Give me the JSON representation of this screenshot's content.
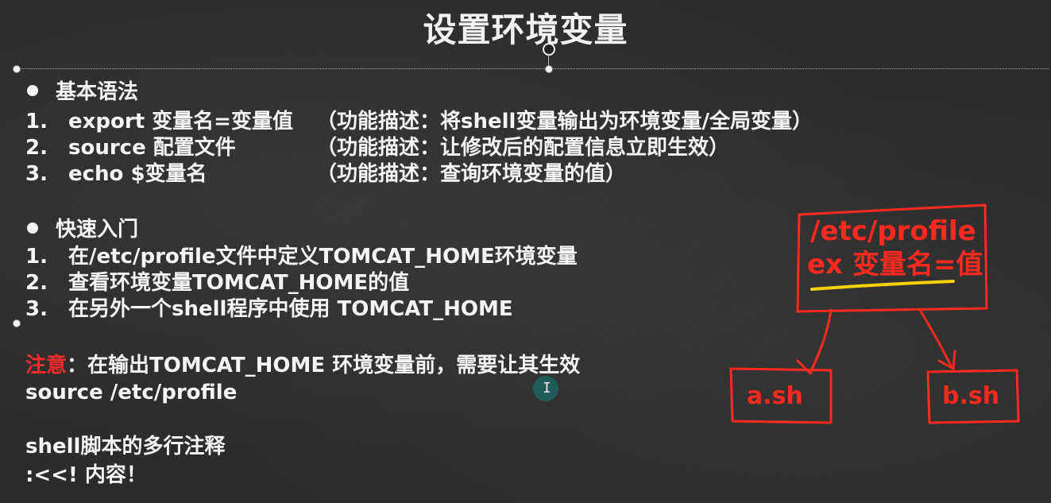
{
  "slide": {
    "title": "设置环境变量",
    "basic_syntax": {
      "heading": "基本语法",
      "items": [
        {
          "num": "1.",
          "cmd": "export 变量名=变量值",
          "desc": "（功能描述：将shell变量输出为环境变量/全局变量）"
        },
        {
          "num": "2.",
          "cmd": "source 配置文件",
          "desc": "（功能描述：让修改后的配置信息立即生效）"
        },
        {
          "num": "3.",
          "cmd": "echo $变量名",
          "desc": "（功能描述：查询环境变量的值）"
        }
      ]
    },
    "quick_start": {
      "heading": "快速入门",
      "items": [
        {
          "num": "1.",
          "text": "在/etc/profile文件中定义TOMCAT_HOME环境变量"
        },
        {
          "num": "2.",
          "text": "查看环境变量TOMCAT_HOME的值"
        },
        {
          "num": "3.",
          "text": "在另外一个shell程序中使用 TOMCAT_HOME"
        }
      ]
    },
    "note": {
      "label": "注意",
      "text": "：在输出TOMCAT_HOME 环境变量前，需要让其生效",
      "command": "source /etc/profile"
    },
    "comment": {
      "heading": "shell脚本的多行注释",
      "syntax": ":<<!   内容！"
    },
    "annotation": {
      "top_box_line1": "/etc/profile",
      "top_box_line2": "ex 变量名=值",
      "left_box": "a.sh",
      "right_box": "b.sh",
      "ink_color": "#ff2a1f",
      "highlight_color": "#f5d20a"
    }
  }
}
